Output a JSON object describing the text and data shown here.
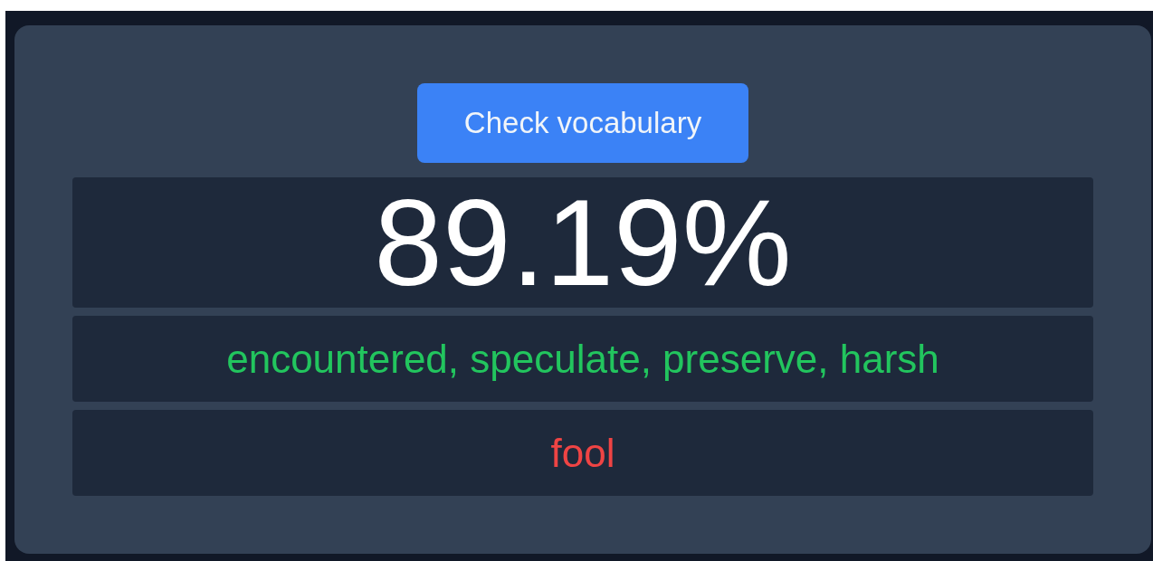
{
  "check_button": {
    "label": "Check vocabulary"
  },
  "score": "89.19%",
  "results": [
    {
      "kind": "known",
      "text": "encountered, speculate, preserve, harsh"
    },
    {
      "kind": "unknown",
      "text": "fool"
    }
  ]
}
